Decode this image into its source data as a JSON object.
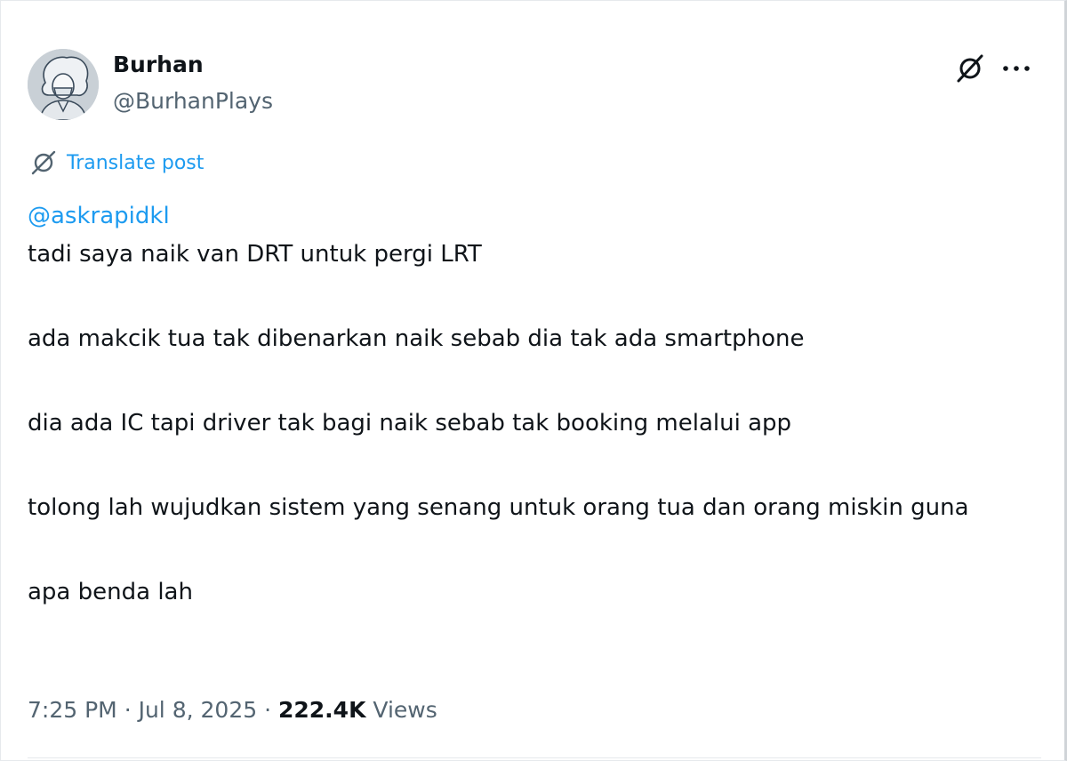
{
  "post": {
    "author": {
      "name": "Burhan",
      "handle": "@BurhanPlays"
    },
    "actions": {
      "grok_icon": "grok-slash-icon",
      "more_icon": "more-horizontal-icon"
    },
    "translate_label": "Translate post",
    "mention": "@askrapidkl",
    "paragraphs": [
      "tadi saya naik van DRT untuk pergi LRT",
      "ada makcik tua tak dibenarkan naik sebab dia tak ada smartphone",
      "dia ada IC tapi driver tak bagi naik sebab tak booking melalui app",
      "tolong lah wujudkan sistem yang senang untuk orang tua dan orang miskin guna",
      "apa benda lah"
    ],
    "meta": {
      "time": "7:25 PM",
      "separator": "·",
      "date": "Jul 8, 2025",
      "views_count": "222.4K",
      "views_label": "Views"
    }
  },
  "colors": {
    "accent": "#1d9bf0",
    "text_primary": "#0f1419",
    "text_secondary": "#536471",
    "divider": "#e6e9ec"
  }
}
